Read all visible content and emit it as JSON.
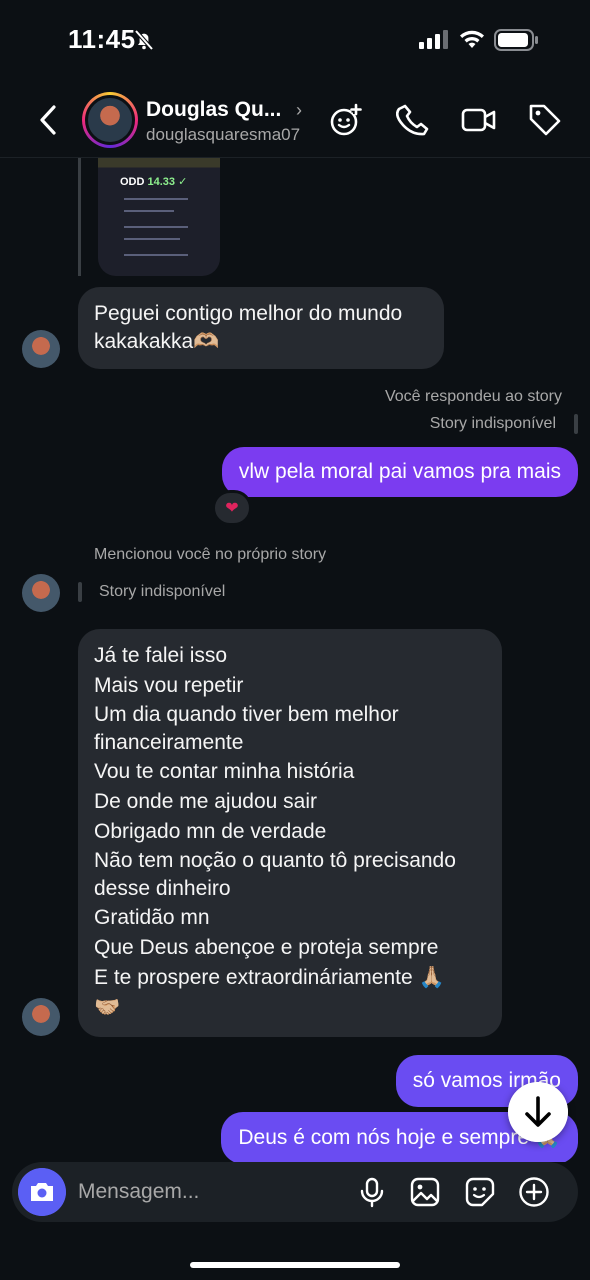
{
  "status_bar": {
    "time": "11:45"
  },
  "header": {
    "name": "Douglas Qu...",
    "chevron": "›",
    "username": "douglasquaresma07",
    "icons": [
      "effects-icon",
      "phone-icon",
      "video-icon",
      "tag-icon"
    ]
  },
  "story_preview": {
    "odd_label": "ODD",
    "odd_value": "14.33 ✓"
  },
  "messages": {
    "m1": {
      "lines": [
        "Peguei contigo melhor do mundo",
        "kakakakka🫶🏼"
      ]
    },
    "reply_meta": "Você respondeu ao story",
    "story_unavailable_1": "Story indisponível",
    "m2": {
      "text": "vlw pela moral pai vamos pra mais"
    },
    "reaction": "❤",
    "mention_meta": "Mencionou você no próprio story",
    "story_unavailable_2": "Story indisponível",
    "m3": {
      "lines": [
        "Já te falei isso",
        "Mais vou repetir",
        "Um dia quando tiver bem melhor",
        "financeiramente",
        "Vou te contar minha história",
        "De onde me ajudou sair",
        "Obrigado mn de verdade",
        "Não tem noção o quanto tô precisando",
        "desse dinheiro",
        "Gratidão mn",
        "Que Deus abençoe e proteja sempre",
        "E te prospere extraordináriamente 🙏🏼",
        "🤝🏼"
      ]
    },
    "m4": {
      "text": "só vamos irmão"
    },
    "m5": {
      "text": "Deus é com nós hoje e sempre 🙏🏼"
    }
  },
  "composer": {
    "placeholder": "Mensagem..."
  },
  "colors": {
    "outgoing": "#7b3cf0",
    "incoming": "#262a30",
    "camera": "#5b5ff4",
    "background": "#0c1014"
  }
}
